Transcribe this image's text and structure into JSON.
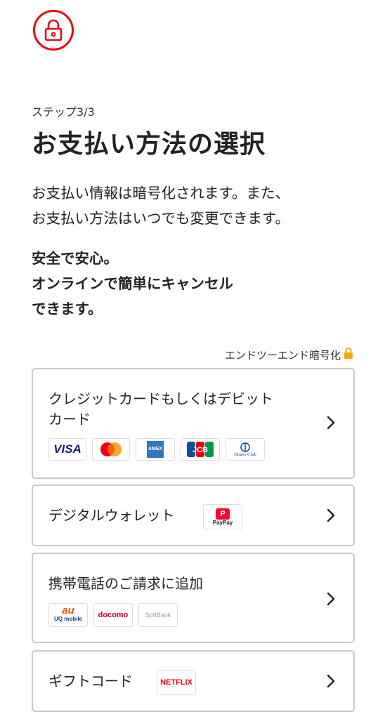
{
  "header": {
    "lock_icon": "lock-icon",
    "brand_color": "#e50914",
    "step_text": "ステップ3/3",
    "title": "お支払い方法の選択"
  },
  "intro": {
    "line1": "お支払い情報は暗号化されます。また、",
    "line2": "お支払い方法はいつでも変更できます。"
  },
  "safety": {
    "line1": "安全で安心。",
    "line2": "オンラインで簡単にキャンセル",
    "line3": "できます。"
  },
  "encryption": {
    "label": "エンドツーエンド暗号化",
    "icon": "padlock-icon"
  },
  "options": {
    "card": {
      "label_line1": "クレジットカードもしくはデビット",
      "label_line2": "カード",
      "logos": [
        "VISA",
        "mastercard",
        "AMEX",
        "JCB",
        "Diners Club"
      ]
    },
    "wallet": {
      "label": "デジタルウォレット",
      "logo_text": "PayPay"
    },
    "carrier": {
      "label": "携帯電話のご請求に追加",
      "logos": {
        "au_top": "au",
        "au_bottom": "UQ mobile",
        "docomo": "docomo",
        "softbank": "SoftBank"
      }
    },
    "gift": {
      "label": "ギフトコード",
      "logo_text": "NETFLIX"
    }
  }
}
